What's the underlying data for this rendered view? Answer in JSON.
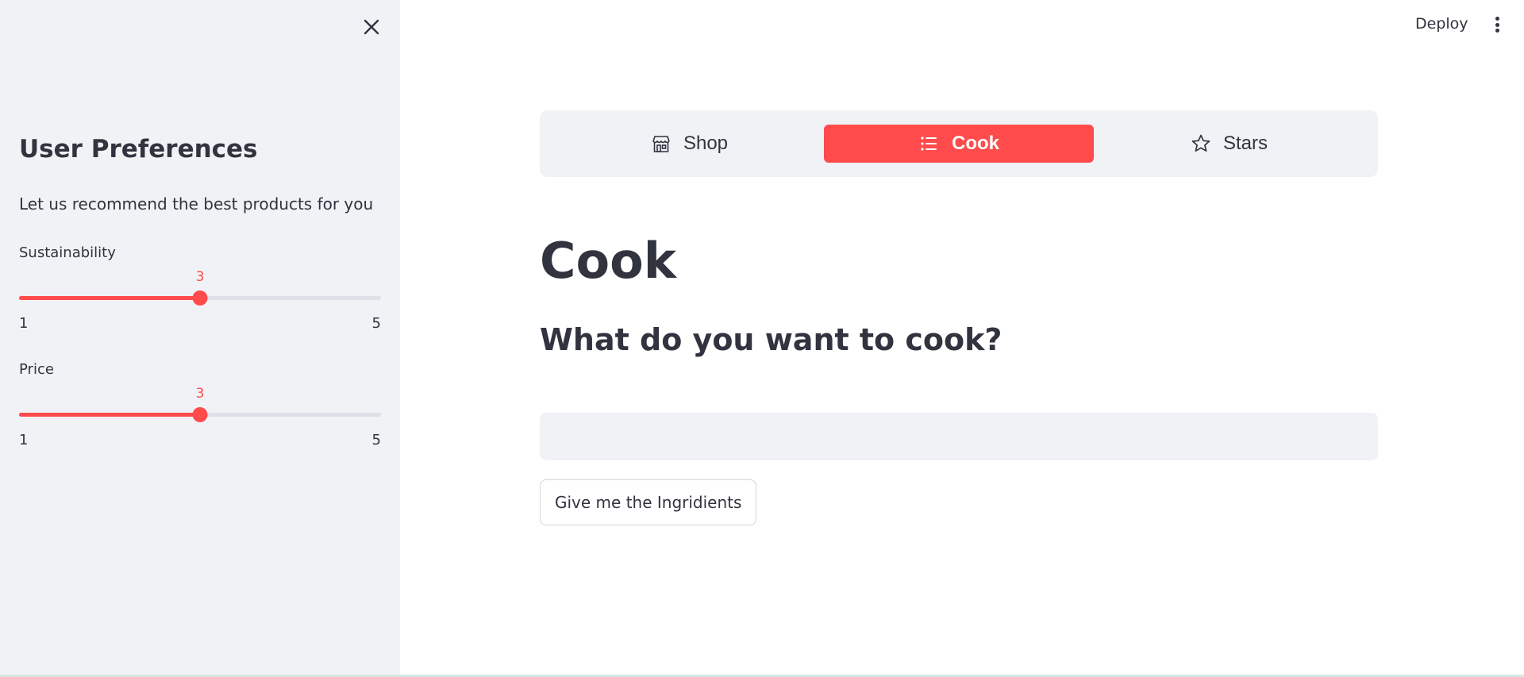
{
  "sidebar": {
    "title": "User Preferences",
    "subtitle": "Let us recommend the best products for you",
    "sliders": [
      {
        "label": "Sustainability",
        "value": "3",
        "min": "1",
        "max": "5",
        "fraction": 0.5
      },
      {
        "label": "Price",
        "value": "3",
        "min": "1",
        "max": "5",
        "fraction": 0.5
      }
    ]
  },
  "header": {
    "deploy_label": "Deploy"
  },
  "nav": {
    "items": [
      {
        "label": "Shop",
        "icon": "shop-icon",
        "active": false
      },
      {
        "label": "Cook",
        "icon": "list-icon",
        "active": true
      },
      {
        "label": "Stars",
        "icon": "star-icon",
        "active": false
      }
    ]
  },
  "main": {
    "title": "Cook",
    "subtitle": "What do you want to cook?",
    "input_value": "",
    "button_label": "Give me the Ingridients"
  },
  "colors": {
    "accent": "#ff4b4b",
    "sidebar_bg": "#f0f2f6",
    "text": "#31333f"
  }
}
